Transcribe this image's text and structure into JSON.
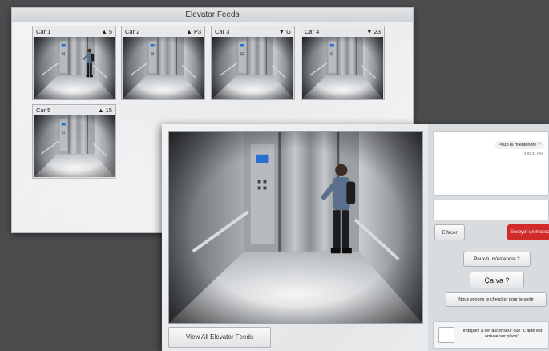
{
  "feeds_window": {
    "title": "Elevator Feeds",
    "tiles": [
      {
        "car": "Car 1",
        "status": "▲ 5"
      },
      {
        "car": "Car 2",
        "status": "▲ P3"
      },
      {
        "car": "Car 3",
        "status": "▼ G"
      },
      {
        "car": "Car 4",
        "status": "▼ 23"
      },
      {
        "car": "Car 5",
        "status": "▲ 15"
      }
    ]
  },
  "detail_window": {
    "view_all_label": "View All Elevator Feeds",
    "chat": {
      "message": "Peux-tu m'entendre ?",
      "timestamp": "4:09:31 PM",
      "input_value": "",
      "clear_label": "Effacer",
      "send_label": "Envoyer un message",
      "quick_replies": [
        "Peux-tu m'entendre ?",
        "Ça va ?",
        "Nous venons te chercher pour te sortir"
      ],
      "confirm_text": "Indiquez à cet ascenseur que \"L'aide est arrivée sur place\"."
    }
  },
  "colors": {
    "send_button": "#d22b2b",
    "background": "#4a4c4e"
  }
}
